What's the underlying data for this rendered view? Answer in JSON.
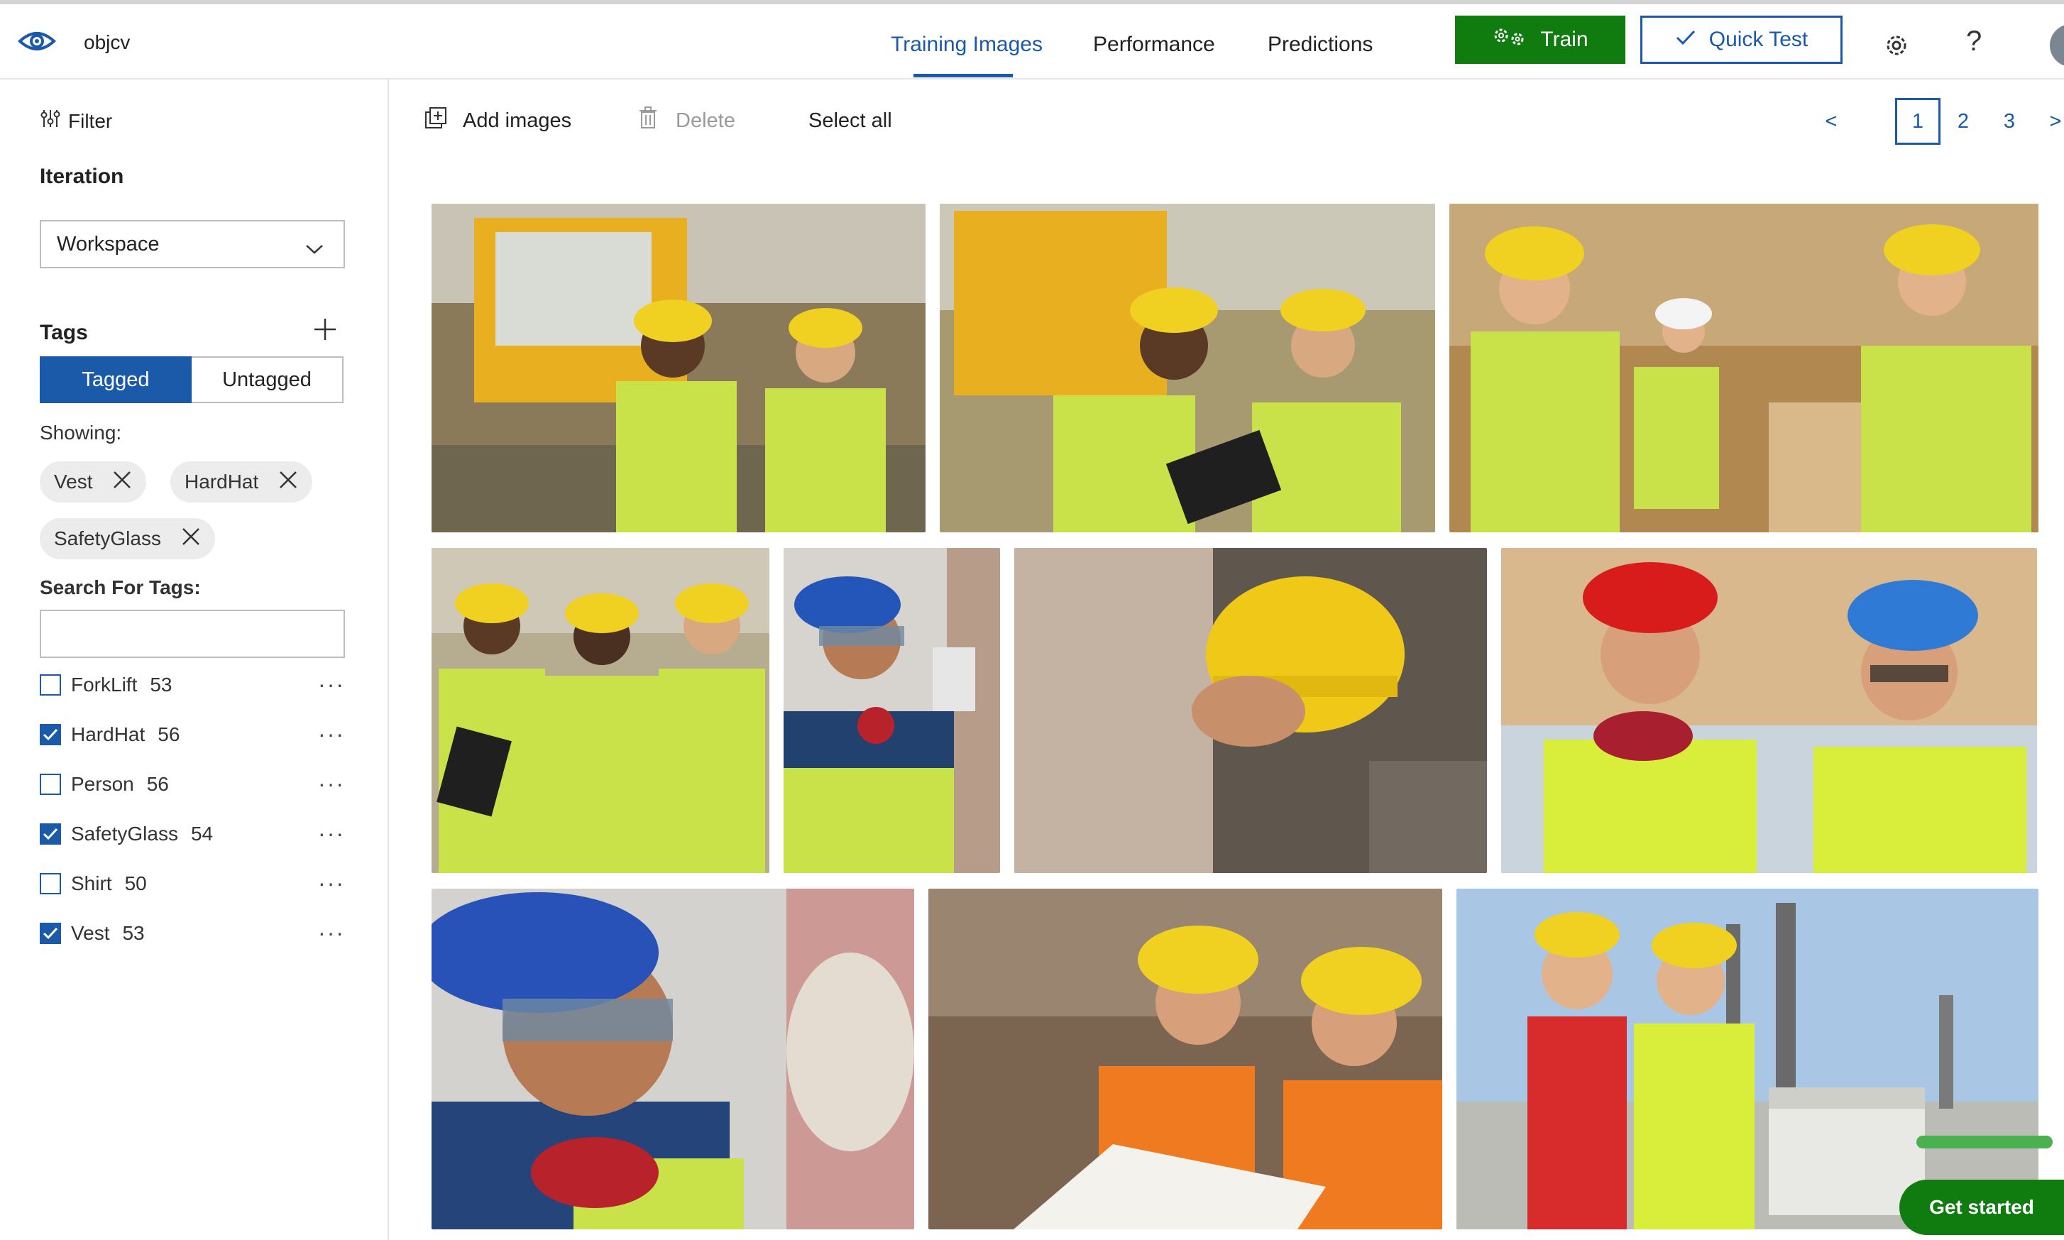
{
  "header": {
    "project_name": "objcv",
    "tabs": [
      {
        "label": "Training Images",
        "active": true
      },
      {
        "label": "Performance",
        "active": false
      },
      {
        "label": "Predictions",
        "active": false
      }
    ],
    "train_label": "Train",
    "quick_test_label": "Quick Test",
    "help_label": "?",
    "accent_color": "#1a5aa8",
    "train_color": "#107c10"
  },
  "sidebar": {
    "filter_label": "Filter",
    "iteration_label": "Iteration",
    "iteration_value": "Workspace",
    "tags_label": "Tags",
    "tagged_label": "Tagged",
    "untagged_label": "Untagged",
    "showing_label": "Showing:",
    "chips": [
      "Vest",
      "HardHat",
      "SafetyGlass"
    ],
    "search_label": "Search For Tags:",
    "search_value": "",
    "tags": [
      {
        "name": "ForkLift",
        "count": "53",
        "checked": false
      },
      {
        "name": "HardHat",
        "count": "56",
        "checked": true
      },
      {
        "name": "Person",
        "count": "56",
        "checked": false
      },
      {
        "name": "SafetyGlass",
        "count": "54",
        "checked": true
      },
      {
        "name": "Shirt",
        "count": "50",
        "checked": false
      },
      {
        "name": "Vest",
        "count": "53",
        "checked": true
      }
    ],
    "more_label": "···"
  },
  "toolbar": {
    "add_images_label": "Add images",
    "delete_label": "Delete",
    "select_all_label": "Select all",
    "pages": [
      "<",
      "1",
      "2",
      "3",
      ">"
    ],
    "current_page": "1"
  },
  "get_started_label": "Get started"
}
